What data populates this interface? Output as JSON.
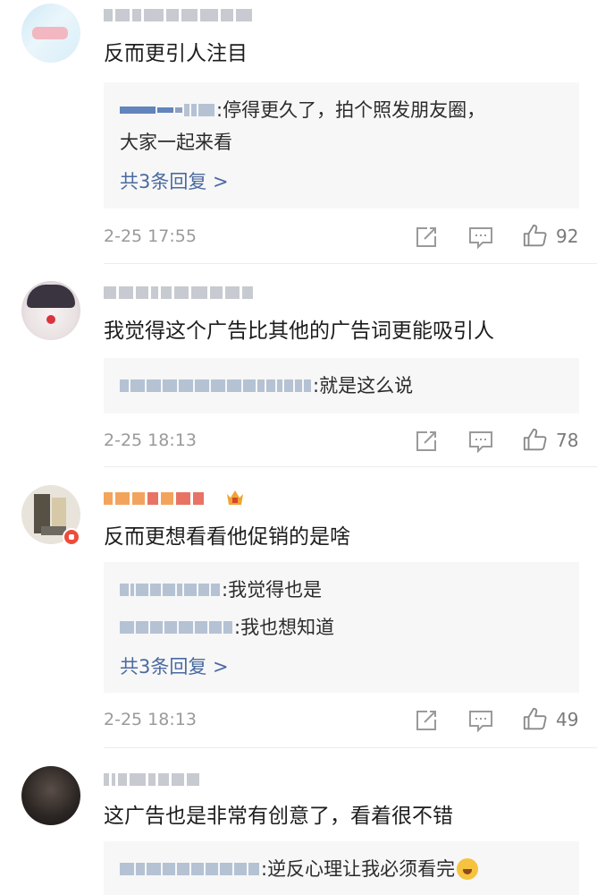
{
  "comments": [
    {
      "text": "反而更引人注目",
      "replies": [
        {
          "sep": ": ",
          "text": "停得更久了，拍个照发朋友圈，"
        },
        {
          "continuation": "大家一起来看"
        }
      ],
      "more_replies": "共3条回复 >",
      "time": "2-25 17:55",
      "likes": "92"
    },
    {
      "text": "我觉得这个广告比其他的广告词更能吸引人",
      "replies": [
        {
          "sep": ": ",
          "text": "就是这么说"
        }
      ],
      "time": "2-25 18:13",
      "likes": "78"
    },
    {
      "text": "反而更想看看他促销的是啥",
      "replies": [
        {
          "sep": ": ",
          "text": "我觉得也是"
        },
        {
          "sep": ": ",
          "text": "我也想知道"
        }
      ],
      "more_replies": "共3条回复 >",
      "time": "2-25 18:13",
      "likes": "49"
    },
    {
      "text": "这广告也是非常有创意了，看着很不错",
      "replies": [
        {
          "sep": ": ",
          "text": "逆反心理让我必须看完"
        }
      ]
    }
  ],
  "icons": {
    "share": "share-icon",
    "comment": "comment-icon",
    "like": "thumbs-up-icon",
    "emoji": "laughing-crying-emoji",
    "vip": "vip-badge-icon"
  },
  "colors": {
    "link": "#4a6aa0",
    "meta": "#9a9a9a",
    "reply_bg": "#f7f7f7"
  }
}
